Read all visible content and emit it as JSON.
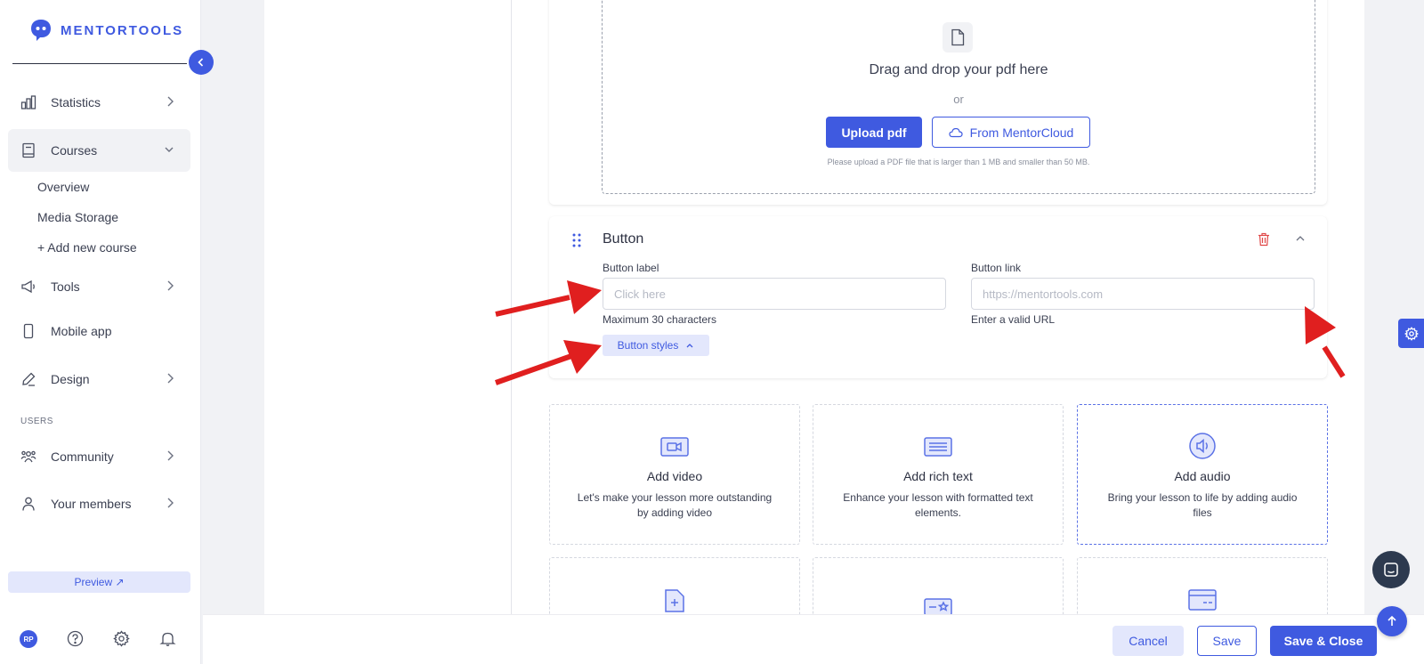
{
  "brand": {
    "name": "MENTORTOOLS",
    "color": "#3f5ae0"
  },
  "sidebar": {
    "items": [
      {
        "label": "Statistics",
        "icon": "bar-chart-icon"
      },
      {
        "label": "Courses",
        "icon": "book-icon"
      },
      {
        "label": "Tools",
        "icon": "megaphone-icon"
      },
      {
        "label": "Mobile app",
        "icon": "phone-icon"
      },
      {
        "label": "Design",
        "icon": "pencil-icon"
      },
      {
        "label": "Community",
        "icon": "community-icon"
      },
      {
        "label": "Your members",
        "icon": "user-icon"
      }
    ],
    "courses_sub": [
      "Overview",
      "Media Storage",
      "+ Add new course"
    ],
    "section_users": "USERS",
    "preview_label": "Preview ↗",
    "avatar_initials": "RP"
  },
  "pdf_block": {
    "drop_title": "Drag and drop your pdf here",
    "or": "or",
    "upload_label": "Upload pdf",
    "cloud_label": "From MentorCloud",
    "hint": "Please upload a PDF file that is larger than 1 MB and smaller than 50 MB."
  },
  "button_block": {
    "title": "Button",
    "label_field": {
      "label": "Button label",
      "placeholder": "Click here",
      "hint": "Maximum 30 characters"
    },
    "link_field": {
      "label": "Button link",
      "placeholder": "https://mentortools.com",
      "hint": "Enter a valid URL"
    },
    "styles_label": "Button styles"
  },
  "add_cards": [
    {
      "title": "Add video",
      "desc": "Let's make your lesson more outstanding by adding video",
      "icon": "video-icon"
    },
    {
      "title": "Add rich text",
      "desc": "Enhance your lesson with formatted text elements.",
      "icon": "rich-text-icon"
    },
    {
      "title": "Add audio",
      "desc": "Bring your lesson to life by adding audio files",
      "icon": "audio-icon"
    }
  ],
  "footer": {
    "cancel": "Cancel",
    "save": "Save",
    "save_close": "Save & Close"
  }
}
